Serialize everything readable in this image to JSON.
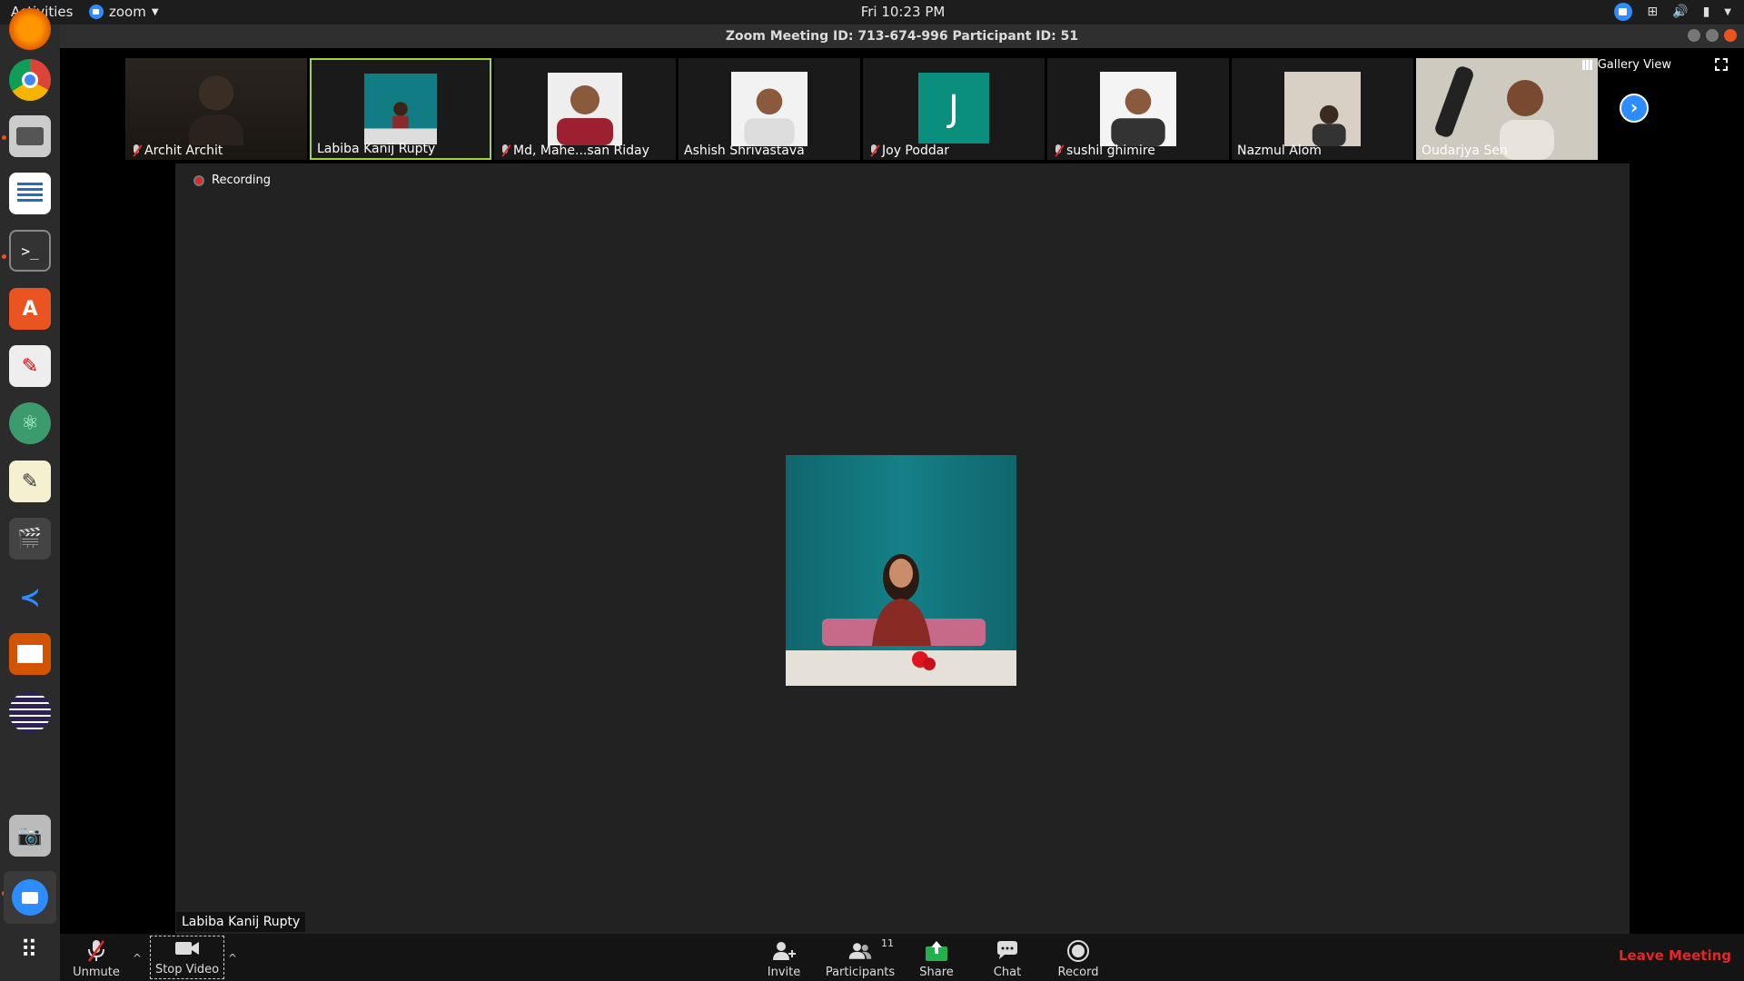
{
  "topbar": {
    "activities": "Activities",
    "app_name": "zoom",
    "clock": "Fri 10:23 PM",
    "tray_icons": [
      "zoom-tray-icon",
      "network-icon",
      "volume-icon",
      "battery-icon",
      "power-menu-icon"
    ]
  },
  "window": {
    "title": "Zoom Meeting ID: 713-674-996 Participant ID: 51"
  },
  "dock": {
    "items": [
      "firefox-icon",
      "chrome-icon",
      "files-icon",
      "writer-icon",
      "terminal-icon",
      "software-center-icon",
      "pdf-viewer-icon",
      "atom-icon",
      "text-editor-icon",
      "video-editor-icon",
      "vscode-icon",
      "impress-icon",
      "eclipse-icon",
      "camera-icon",
      "zoom-icon",
      "show-apps-icon"
    ]
  },
  "gallery_view_label": "Gallery View",
  "participants": [
    {
      "name": "Archit Archit",
      "muted": true
    },
    {
      "name": "Labiba Kanij Rupty",
      "muted": false,
      "active": true
    },
    {
      "name": "Md, Mahe...san Riday",
      "muted": true
    },
    {
      "name": "Ashish Shrivastava",
      "muted": false
    },
    {
      "name": "Joy Poddar",
      "muted": true,
      "initial": "J"
    },
    {
      "name": "sushil ghimire",
      "muted": true
    },
    {
      "name": "Nazmul Alom",
      "muted": false
    },
    {
      "name": "Oudarjya Sen",
      "muted": false
    }
  ],
  "recording_label": "Recording",
  "active_speaker": "Labiba Kanij Rupty",
  "toolbar": {
    "unmute": "Unmute",
    "stop_video": "Stop Video",
    "invite": "Invite",
    "participants": "Participants",
    "participants_count": "11",
    "share": "Share",
    "chat": "Chat",
    "record": "Record",
    "leave": "Leave Meeting"
  },
  "colors": {
    "accent": "#2d8cff",
    "active_border": "#9ed33a",
    "leave": "#e02828",
    "share_green": "#22b14c"
  }
}
